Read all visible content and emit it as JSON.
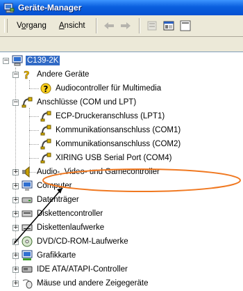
{
  "window": {
    "title": "Geräte-Manager"
  },
  "menu": [
    {
      "label": "Vorgang",
      "underline_index": 1
    },
    {
      "label": "Ansicht",
      "underline_index": 0
    }
  ],
  "toolbar": {
    "buttons": [
      "back-icon",
      "forward-icon",
      "properties-icon",
      "console-icon",
      "help-icon"
    ]
  },
  "tree": {
    "root": {
      "label": "C139-2K",
      "selected": true,
      "icon": "computer-icon"
    },
    "items": [
      {
        "label": "Andere Geräte",
        "icon": "question-icon",
        "expanded": true
      },
      {
        "label": "Audiocontroller für Multimedia",
        "icon": "warning-device-icon"
      },
      {
        "label": "Anschlüsse (COM und LPT)",
        "icon": "port-icon",
        "expanded": true
      },
      {
        "label": "ECP-Druckeranschluss (LPT1)",
        "icon": "port-icon"
      },
      {
        "label": "Kommunikationsanschluss (COM1)",
        "icon": "port-icon"
      },
      {
        "label": "Kommunikationsanschluss (COM2)",
        "icon": "port-icon"
      },
      {
        "label": "XIRING USB Serial Port (COM4)",
        "icon": "port-icon",
        "highlighted": true
      },
      {
        "label": "Audio-, Video- und Gamecontroller",
        "icon": "audio-icon"
      },
      {
        "label": "Computer",
        "icon": "monitor-icon"
      },
      {
        "label": "Datenträger",
        "icon": "drive-icon"
      },
      {
        "label": "Diskettencontroller",
        "icon": "floppy-controller-icon"
      },
      {
        "label": "Diskettenlaufwerke",
        "icon": "floppy-icon"
      },
      {
        "label": "DVD/CD-ROM-Laufwerke",
        "icon": "cdrom-icon"
      },
      {
        "label": "Grafikkarte",
        "icon": "display-adapter-icon"
      },
      {
        "label": "IDE ATA/ATAPI-Controller",
        "icon": "ide-icon"
      },
      {
        "label": "Mäuse und andere Zeigegeräte",
        "icon": "mouse-icon"
      }
    ]
  },
  "colors": {
    "titlebar": "#0a5fde",
    "selection": "#316ac5",
    "annotation": "#f07820"
  }
}
